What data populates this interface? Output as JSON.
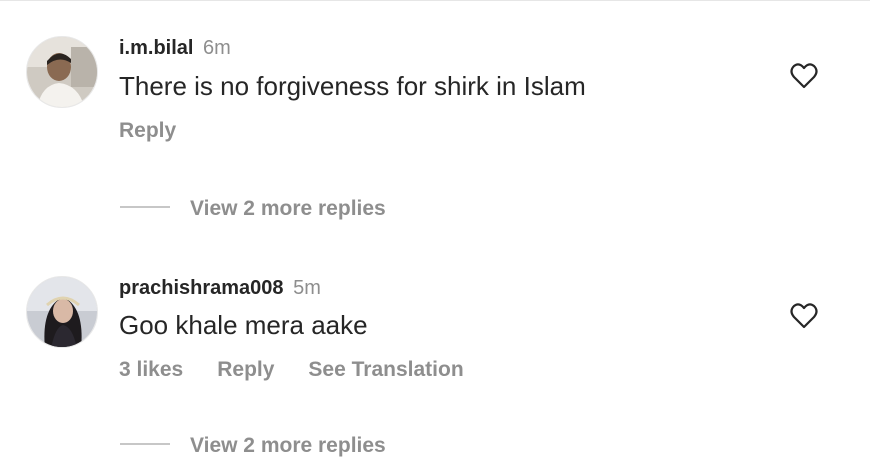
{
  "comments": [
    {
      "username": "i.m.bilal",
      "time": "6m",
      "text": "There is no forgiveness for shirk in Islam",
      "actions": [
        "Reply"
      ],
      "view_replies": "View 2 more replies",
      "icons": {
        "like": "heart-outline-icon",
        "avatar": "user-avatar"
      }
    },
    {
      "username": "prachishrama008",
      "time": "5m",
      "text": "Goo khale mera aake",
      "actions": [
        "3 likes",
        "Reply",
        "See Translation"
      ],
      "view_replies": "View 2 more replies",
      "icons": {
        "like": "heart-outline-icon",
        "avatar": "user-avatar"
      }
    }
  ],
  "colors": {
    "primary_text": "#262626",
    "secondary_text": "#8e8e8e",
    "divider": "#c7c7c7"
  }
}
